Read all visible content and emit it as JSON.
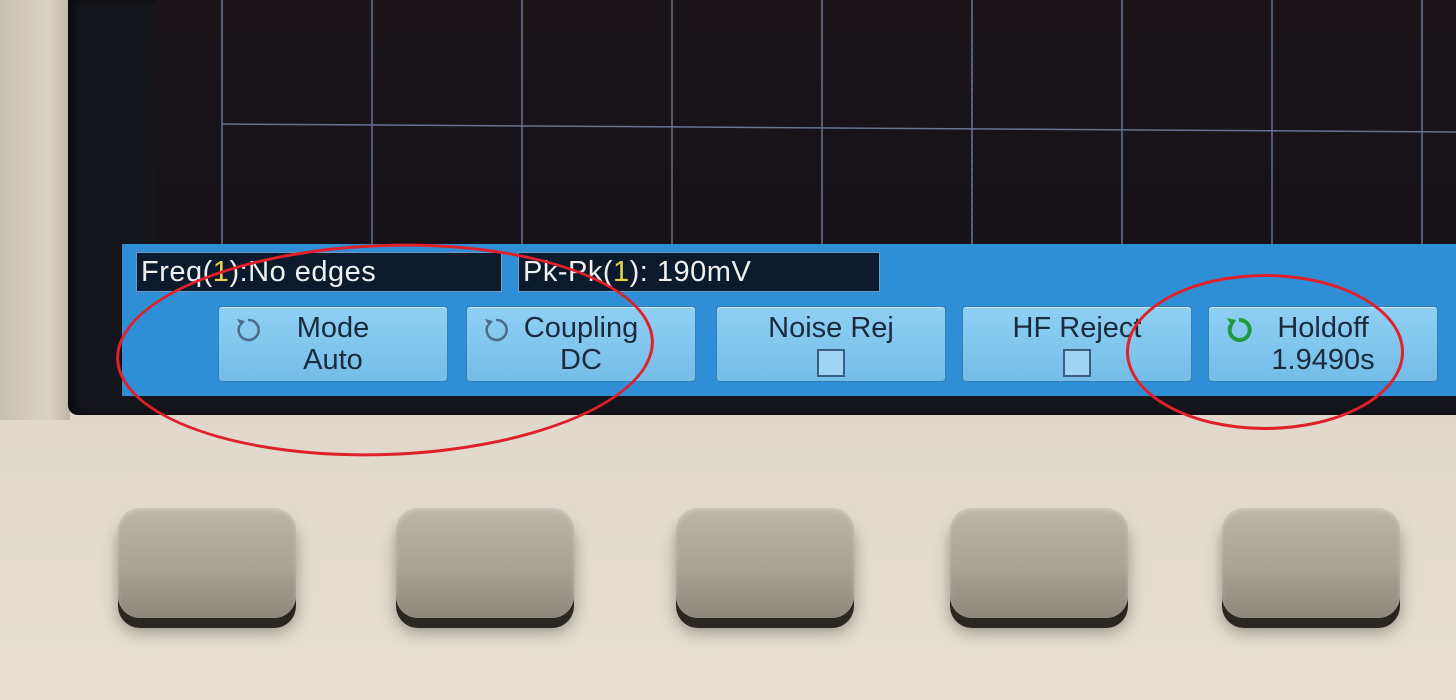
{
  "measurements": {
    "freq": {
      "prefix": "Freq(",
      "channel": "1",
      "suffix": "):No edges"
    },
    "pkpk": {
      "prefix": "Pk-Pk(",
      "channel": "1",
      "suffix": "): 190mV"
    }
  },
  "softkeys": [
    {
      "label": "Mode",
      "value": "Auto",
      "icon": "rotate-icon"
    },
    {
      "label": "Coupling",
      "value": "DC",
      "icon": "rotate-icon"
    },
    {
      "label": "Noise Rej",
      "value": "",
      "icon": "checkbox"
    },
    {
      "label": "HF Reject",
      "value": "",
      "icon": "checkbox"
    },
    {
      "label": "Holdoff",
      "value": "1.9490s",
      "icon": "green-rotate-icon"
    }
  ],
  "colors": {
    "panel": "#2f8fd6",
    "softkey": "#8fd0f4",
    "channel1": "#e8d34a",
    "highlight": "#e0202a",
    "grid": "#7f93b8"
  }
}
